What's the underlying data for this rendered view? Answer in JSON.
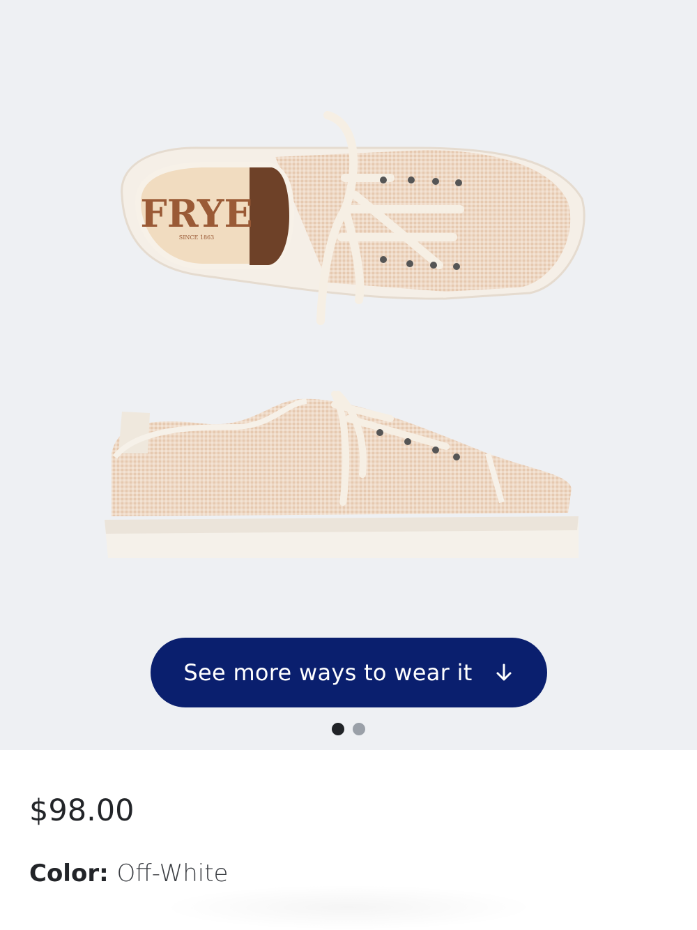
{
  "product_image": {
    "brand_text": "FRYE",
    "brand_subtext": "SINCE 1863",
    "alt": "sneaker-image"
  },
  "cta": {
    "label": "See more ways to wear it",
    "icon": "arrow-down-icon"
  },
  "carousel": {
    "count": 2,
    "active_index": 0
  },
  "price": "$98.00",
  "color": {
    "label": "Color:",
    "value": "Off-White"
  },
  "colors": {
    "cta_background": "#0a1f6e",
    "hero_background": "#eef0f3"
  }
}
